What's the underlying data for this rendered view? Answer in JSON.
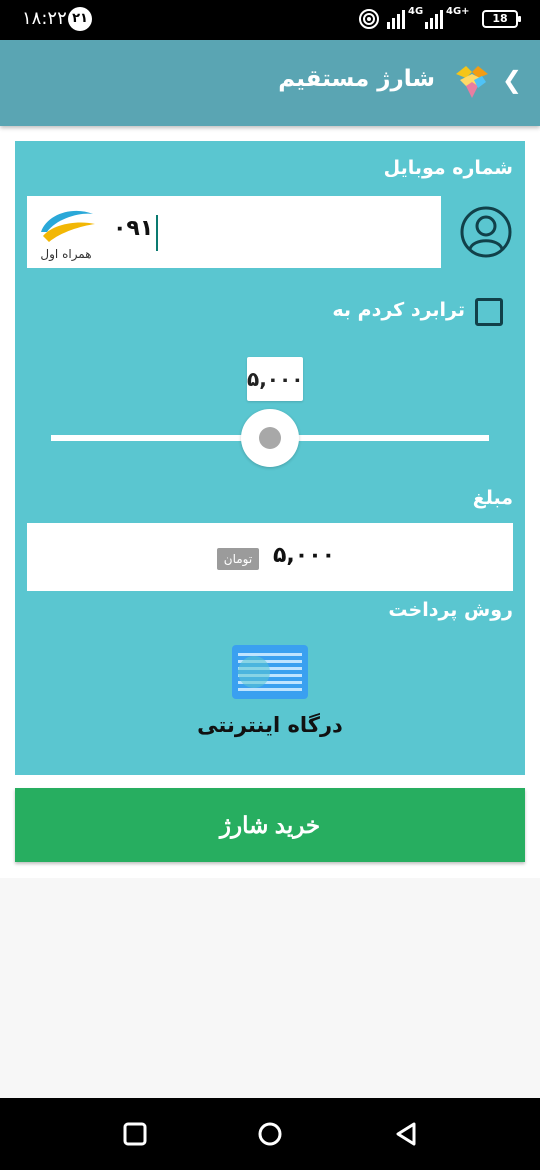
{
  "status_bar": {
    "time": "۱۸:۲۲",
    "notification_badge": "۲۱",
    "network_1": "4G",
    "network_2": "4G+",
    "battery": "18"
  },
  "app_bar": {
    "title": "شارژ مستقیم",
    "back_icon": "chevron-left-icon",
    "logo_icon": "app-logo-icon"
  },
  "form": {
    "mobile_label": "شماره موبایل",
    "mobile_value": "۰۹۱",
    "operator_logo_text": "همراه اول",
    "transfer_label": "ترابرد کردم به",
    "transfer_checked": false,
    "slider_value": "۵,۰۰۰",
    "slider_fraction": 0.5,
    "amount_label": "مبلغ",
    "amount_value": "۵,۰۰۰",
    "amount_unit": "تومان",
    "payment_label": "روش پرداخت",
    "gateway_label": "درگاه اینترنتی"
  },
  "buy_button": {
    "label": "خرید شارژ"
  },
  "colors": {
    "app_bar": "#5aa5b3",
    "card": "#5ac6d0",
    "button": "#27ae60"
  }
}
